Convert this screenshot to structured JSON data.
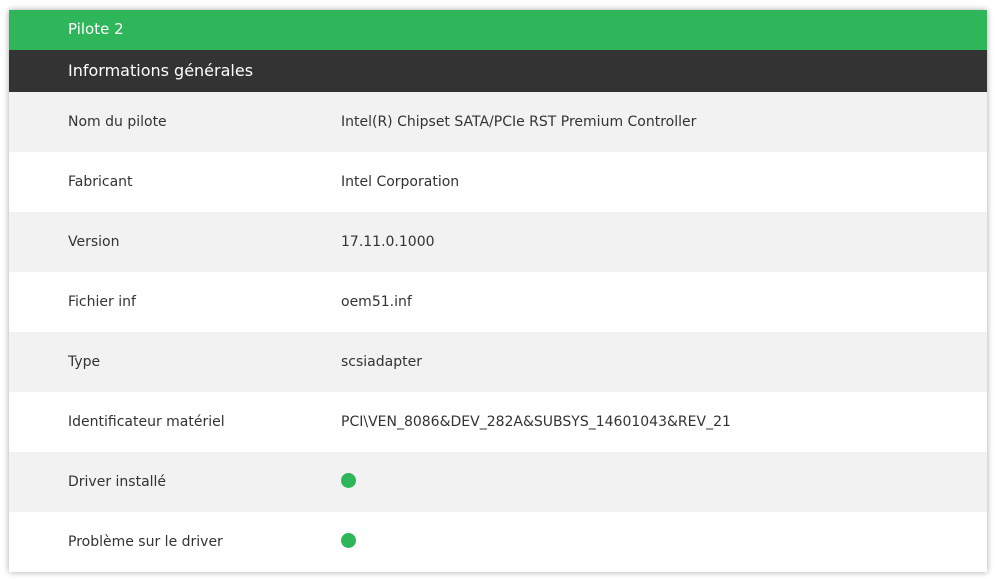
{
  "panel": {
    "title": "Pilote 2",
    "section_title": "Informations générales",
    "accent_color": "#2fb55a",
    "section_color": "#333333"
  },
  "rows": [
    {
      "label": "Nom du pilote",
      "value": "Intel(R) Chipset SATA/PCIe RST Premium Controller"
    },
    {
      "label": "Fabricant",
      "value": "Intel Corporation"
    },
    {
      "label": "Version",
      "value": "17.11.0.1000"
    },
    {
      "label": "Fichier inf",
      "value": "oem51.inf"
    },
    {
      "label": "Type",
      "value": "scsiadapter"
    },
    {
      "label": "Identificateur matériel",
      "value": "PCI\\VEN_8086&DEV_282A&SUBSYS_14601043&REV_21"
    },
    {
      "label": "Driver installé",
      "status_icon": "green-status-dot",
      "status": "ok"
    },
    {
      "label": "Problème sur le driver",
      "status_icon": "green-status-dot",
      "status": "ok"
    }
  ]
}
